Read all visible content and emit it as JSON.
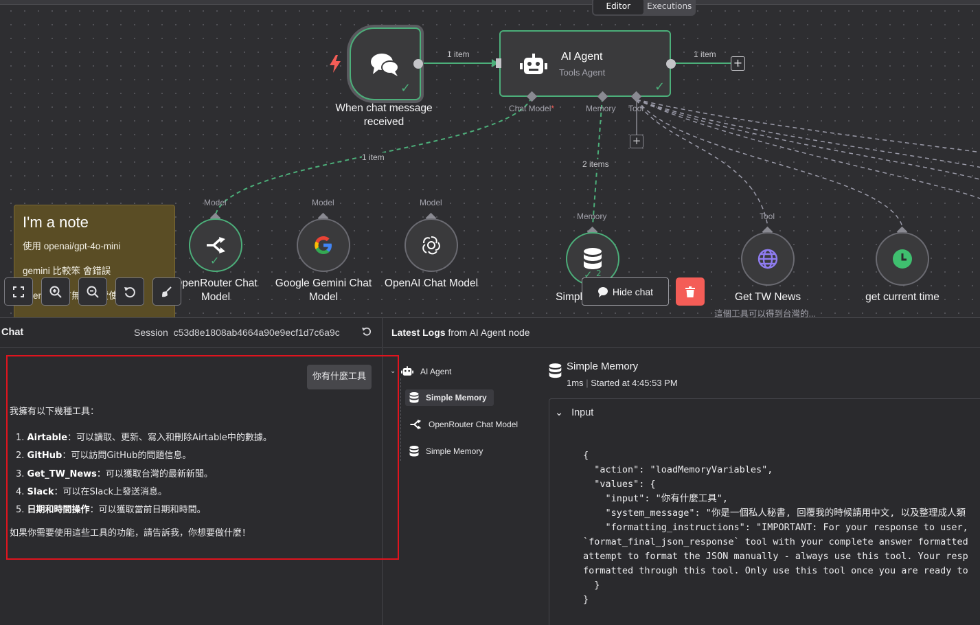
{
  "tabs": {
    "editor": "Editor",
    "executions": "Executions"
  },
  "canvas": {
    "trigger": {
      "label": "When chat message received",
      "icon": "chat-bubbles-icon"
    },
    "edge_trigger_agent": "1 item",
    "agent": {
      "title": "AI Agent",
      "subtitle": "Tools Agent",
      "ports": {
        "chat_model": "Chat Model",
        "chat_model_required": "*",
        "memory": "Memory",
        "tool": "Tool"
      }
    },
    "edge_agent_out": "1 item",
    "edge_model": "1 item",
    "edge_memory": "2 items",
    "sub_nodes": [
      {
        "port": "Model",
        "label": "OpenRouter Chat Model",
        "icon": "openrouter-icon",
        "status": "ok"
      },
      {
        "port": "Model",
        "label": "Google Gemini Chat Model",
        "icon": "google-g-icon",
        "status": ""
      },
      {
        "port": "Model",
        "label": "OpenAI Chat Model",
        "icon": "openai-icon",
        "status": ""
      },
      {
        "port": "Memory",
        "label": "Simple Memory",
        "icon": "database-icon",
        "status": "ok",
        "badge": "2"
      },
      {
        "port": "Tool",
        "label": "Get TW News",
        "icon": "globe-icon",
        "status": "",
        "note": "這個工具可以得到台灣的..."
      },
      {
        "port": "Tool",
        "label": "get current time",
        "icon": "clock-icon",
        "status": ""
      }
    ],
    "note": {
      "title": "I'm a note",
      "lines": [
        "使用 openai/gpt-4o-mini",
        "gemini 比較笨 會錯誤",
        "openai 官方無法免費使用"
      ]
    },
    "toolbar": {
      "hide_chat": "Hide chat"
    }
  },
  "chat": {
    "title": "Chat",
    "session_label": "Session",
    "session_id": "c53d8e1808ab4664a90e9ecf1d7c6a9c",
    "user_message": "你有什麼工具",
    "reply_intro": "我擁有以下幾種工具：",
    "tools": [
      {
        "num": "1.",
        "name": "Airtable",
        "desc": "：可以讀取、更新、寫入和刪除Airtable中的數據。"
      },
      {
        "num": "2.",
        "name": "GitHub",
        "desc": "：可以訪問GitHub的問題信息。"
      },
      {
        "num": "3.",
        "name": "Get_TW_News",
        "desc": "：可以獲取台灣的最新新聞。"
      },
      {
        "num": "4.",
        "name": "Slack",
        "desc": "：可以在Slack上發送消息。"
      },
      {
        "num": "5.",
        "name": "日期和時間操作",
        "desc": "：可以獲取當前日期和時間。"
      }
    ],
    "reply_outro": "如果你需要使用這些工具的功能，請告訴我，你想要做什麼！"
  },
  "logs": {
    "title_bold": "Latest Logs",
    "title_rest": "from AI Agent node",
    "tree": [
      {
        "label": "AI Agent",
        "icon": "robot-icon"
      },
      {
        "label": "Simple Memory",
        "icon": "database-icon",
        "selected": true
      },
      {
        "label": "OpenRouter Chat Model",
        "icon": "openrouter-icon"
      },
      {
        "label": "Simple Memory",
        "icon": "database-icon"
      }
    ],
    "detail": {
      "title": "Simple Memory",
      "duration": "1ms",
      "started": "Started at 4:45:53 PM",
      "section": "Input"
    },
    "json_lines": [
      "{",
      "  \"action\": \"loadMemoryVariables\",",
      "  \"values\": {",
      "    \"input\": \"你有什麼工具\",",
      "    \"system_message\": \"你是一個私人秘書, 回覆我的時候請用中文, 以及整理成人類",
      "    \"formatting_instructions\": \"IMPORTANT: For your response to user,",
      "`format_final_json_response` tool with your complete answer formatted",
      "attempt to format the JSON manually - always use this tool. Your resp",
      "formatted through this tool. Only use this tool once you are ready to",
      "  }",
      "}"
    ]
  }
}
